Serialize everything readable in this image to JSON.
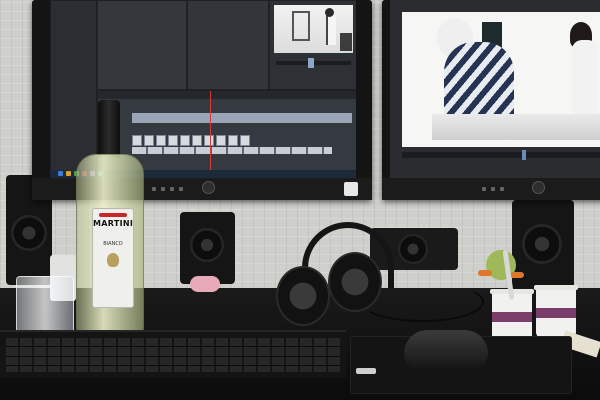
{
  "photo": {
    "bottle_label": {
      "brand": "MARTINI",
      "variant": "BIANCO"
    }
  },
  "colors": {
    "playhead": "#d23c3c",
    "label_red": "#c8262c",
    "timeline_clip": "#d7dbe0"
  },
  "icons": [
    "power-icon",
    "play-icon"
  ]
}
